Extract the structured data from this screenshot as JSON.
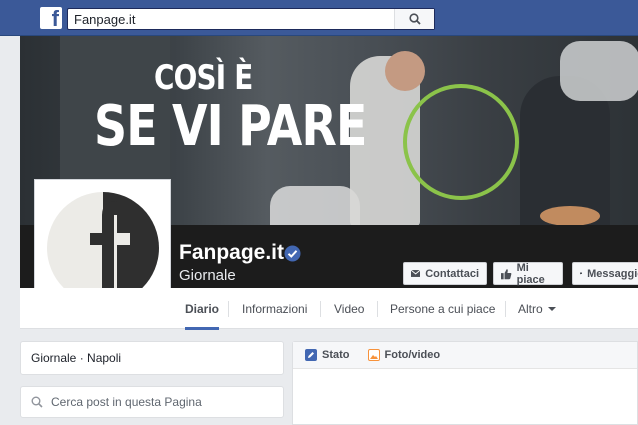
{
  "header": {
    "logo_letter": "f",
    "search_value": "Fanpage.it"
  },
  "cover": {
    "line1": "COSÌ È",
    "line2": "SE VI PARE",
    "accent_circle_color": "#8bc34a"
  },
  "page": {
    "name": "Fanpage.it",
    "category": "Giornale",
    "verified": true
  },
  "actions": {
    "contact_label": "Contattaci",
    "like_label": "Mi piace",
    "message_label": "Messaggio"
  },
  "tabs": [
    {
      "label": "Diario",
      "active": true
    },
    {
      "label": "Informazioni",
      "active": false
    },
    {
      "label": "Video",
      "active": false
    },
    {
      "label": "Persone a cui piace",
      "active": false
    },
    {
      "label": "Altro",
      "active": false
    }
  ],
  "sidebar": {
    "info_text": "Giornale · Napoli",
    "search_placeholder": "Cerca post in questa Pagina"
  },
  "composer": {
    "tabs": [
      {
        "label": "Stato",
        "icon": "pencil-icon",
        "color": "#4267b2"
      },
      {
        "label": "Foto/video",
        "icon": "photo-icon",
        "color": "#f7923b"
      }
    ]
  },
  "colors": {
    "brand": "#3b5998",
    "accent": "#4267b2"
  }
}
